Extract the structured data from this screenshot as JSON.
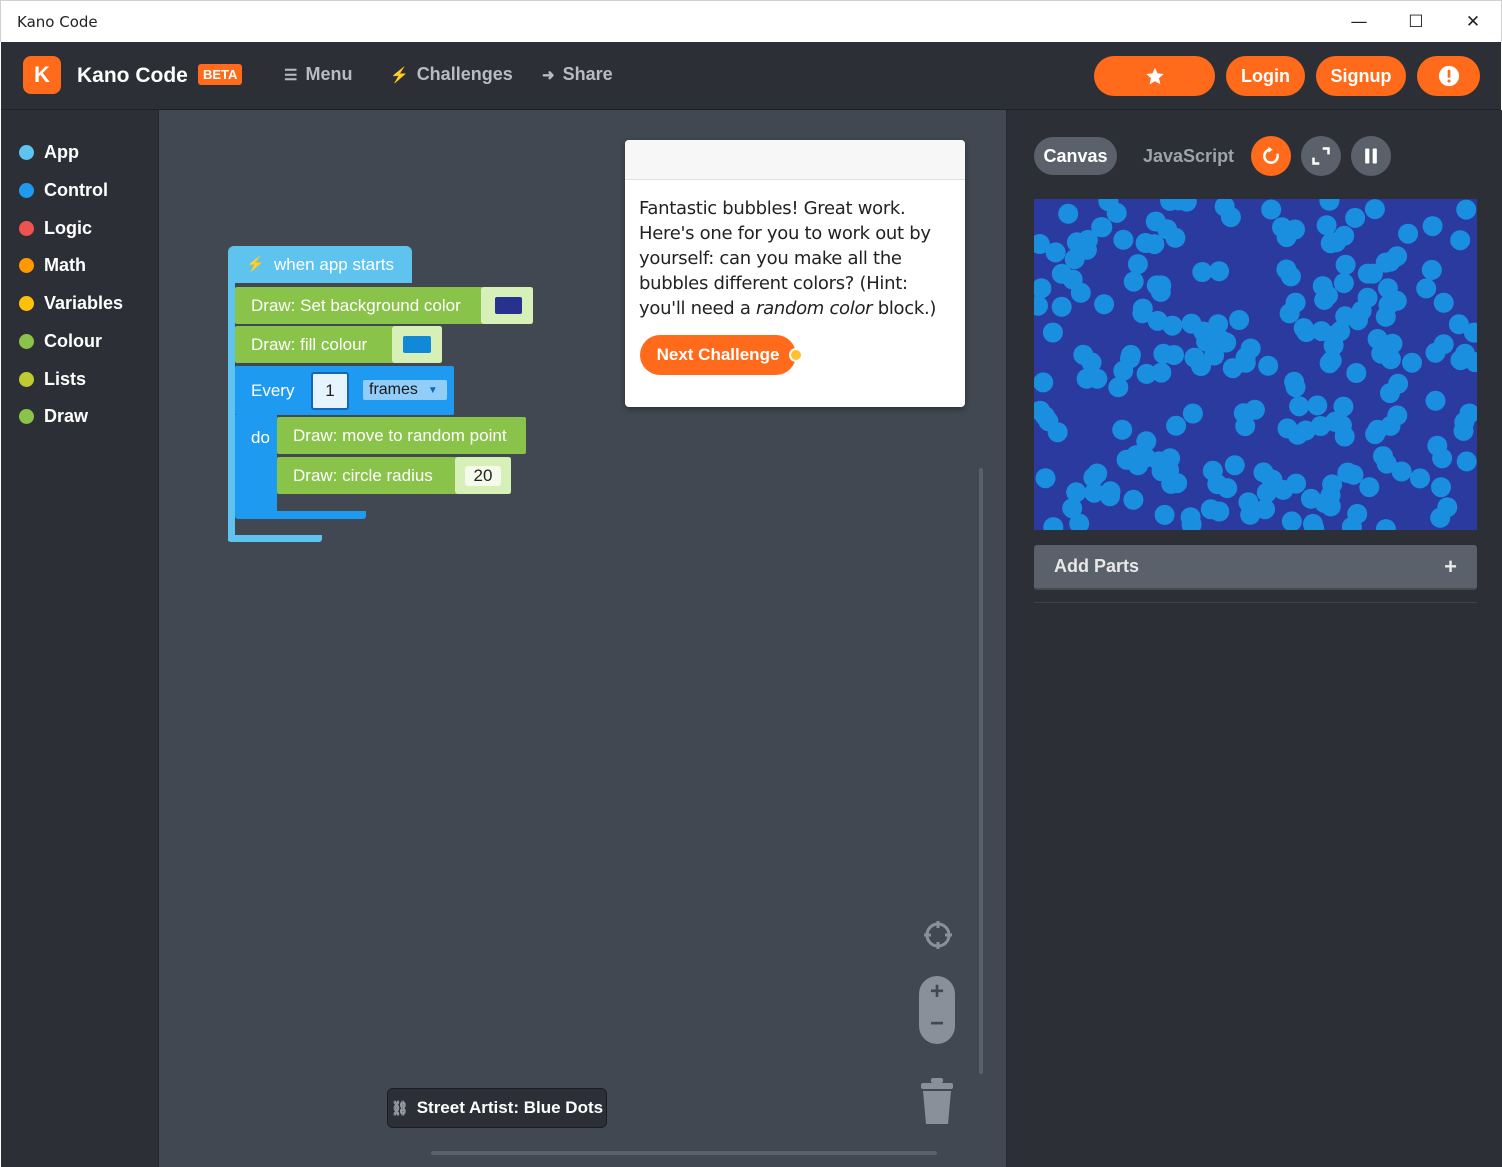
{
  "window": {
    "title": "Kano Code",
    "controls": {
      "minimize": "—",
      "maximize": "☐",
      "close": "✕"
    }
  },
  "header": {
    "logo_letter": "K",
    "brand": "Kano Code",
    "beta": "BETA",
    "nav": [
      {
        "label": "Menu",
        "icon": "hamburger-icon"
      },
      {
        "label": "Challenges",
        "icon": "lightning-icon"
      },
      {
        "label": "Share",
        "icon": "share-arrow-icon"
      }
    ],
    "buttons": {
      "star_icon": "star-icon",
      "login": "Login",
      "signup": "Signup",
      "alert_icon": "exclamation-icon"
    }
  },
  "sidebar": {
    "categories": [
      {
        "label": "App",
        "color": "#5fc3ef"
      },
      {
        "label": "Control",
        "color": "#1e9bf0"
      },
      {
        "label": "Logic",
        "color": "#ef5350"
      },
      {
        "label": "Math",
        "color": "#ff9800"
      },
      {
        "label": "Variables",
        "color": "#ffc107"
      },
      {
        "label": "Colour",
        "color": "#8ac34a"
      },
      {
        "label": "Lists",
        "color": "#c0ca33"
      },
      {
        "label": "Draw",
        "color": "#8ac34a"
      }
    ]
  },
  "workspace": {
    "blocks": {
      "hat": "when app starts",
      "set_bg": "Draw: Set background color",
      "bg_color": "#27328f",
      "fill": "Draw: fill colour",
      "fill_color": "#1188d8",
      "every": "Every",
      "every_value": "1",
      "every_unit": "frames",
      "do": "do",
      "move": "Draw: move to random point",
      "circle": "Draw: circle radius",
      "radius": "20"
    },
    "card": {
      "text_part1": "Fantastic bubbles! Great work. Here's one for you to work out by yourself: can you make all the bubbles different colors? (Hint: you'll need a ",
      "text_em": "random color",
      "text_part2": " block.)",
      "next_button": "Next Challenge"
    },
    "challenge_tag": "Street Artist: Blue Dots"
  },
  "right_panel": {
    "tabs": {
      "canvas": "Canvas",
      "javascript": "JavaScript"
    },
    "controls": [
      "restart-icon",
      "fullscreen-icon",
      "pause-icon"
    ],
    "stage_background": "#2b3a9f",
    "dot_color": "#1a8fe0",
    "add_parts": "Add Parts",
    "add_icon": "+"
  }
}
